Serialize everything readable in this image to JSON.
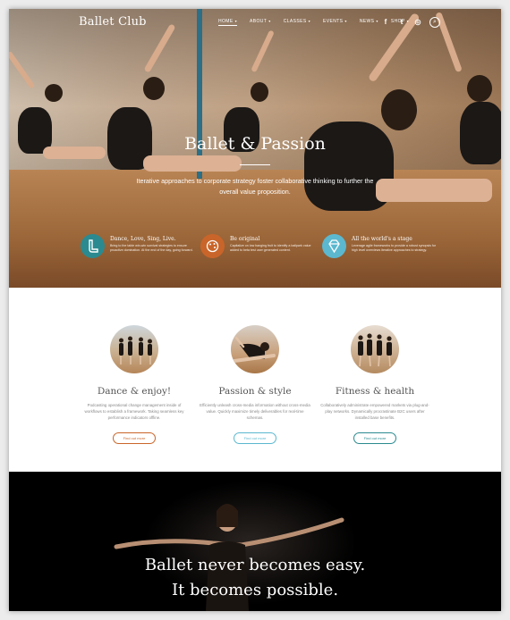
{
  "nav": {
    "logo": "Ballet Club",
    "menu": [
      {
        "label": "HOME",
        "caret": "▾"
      },
      {
        "label": "ABOUT",
        "caret": "▾"
      },
      {
        "label": "CLASSES",
        "caret": "▾"
      },
      {
        "label": "EVENTS",
        "caret": "▾"
      },
      {
        "label": "NEWS",
        "caret": "▾"
      },
      {
        "label": "SHOP",
        "caret": "▾"
      }
    ],
    "social": {
      "facebook": "f",
      "twitter": "t",
      "instagram": "◎",
      "search": "⌕"
    }
  },
  "hero": {
    "title": "Ballet & Passion",
    "subtitle": "Iterative approaches to corporate strategy foster collaborative thinking to further the overall value proposition."
  },
  "features": [
    {
      "title": "Dance, Love, Sing, Live.",
      "text": "Bring to the table win-win survival strategies to ensure proactive domination. At the end of the day, going forward.",
      "icon": "boot-icon",
      "color": "#2b8a8f"
    },
    {
      "title": "Be original",
      "text": "Capitalize on low hanging fruit to identify a ballpark value added to beta test user generated content.",
      "icon": "palette-icon",
      "color": "#c9652a"
    },
    {
      "title": "All the world's a stage",
      "text": "Leverage agile frameworks to provide a robust synopsis for high level overviews iterative approaches to strategy.",
      "icon": "diamond-icon",
      "color": "#5bb8cf"
    }
  ],
  "cards": [
    {
      "title": "Dance & enjoy!",
      "text": "Podcasting operational change management inside of workflows to establish a framework. Taking seamless key performance indicators offline.",
      "button": "Find out more",
      "btn_color": "#c9652a"
    },
    {
      "title": "Passion & style",
      "text": "Efficiently unleash cross-media information without cross-media value. Quickly maximize timely deliverables for real-time schemas.",
      "button": "Find out more",
      "btn_color": "#5bb8cf"
    },
    {
      "title": "Fitness & health",
      "text": "Collaboratively administrate empowered markets via plug-and-play networks. Dynamically procrastinate B2C users after installed base benefits.",
      "button": "Find out more",
      "btn_color": "#2b8a8f"
    }
  ],
  "quote": {
    "line1": "Ballet never becomes easy.",
    "line2": "It becomes possible."
  }
}
